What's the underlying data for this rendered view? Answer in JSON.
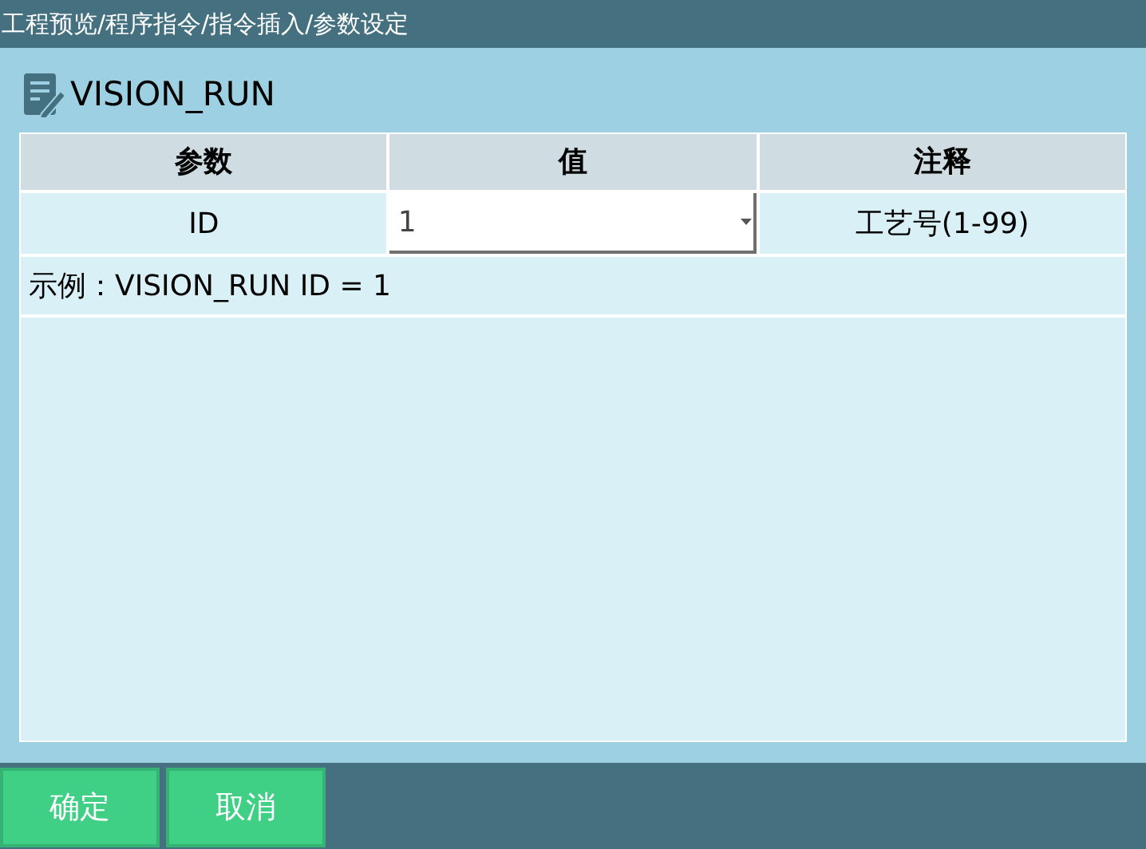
{
  "window": {
    "title": "工程预览/程序指令/指令插入/参数设定"
  },
  "command": {
    "name": "VISION_RUN"
  },
  "table": {
    "columns": [
      "参数",
      "值",
      "注释"
    ],
    "rows": [
      {
        "param": "ID",
        "value": "1",
        "comment": "工艺号(1-99)"
      }
    ],
    "example": "示例：VISION_RUN ID = 1"
  },
  "buttons": [
    "确定",
    "取消"
  ]
}
